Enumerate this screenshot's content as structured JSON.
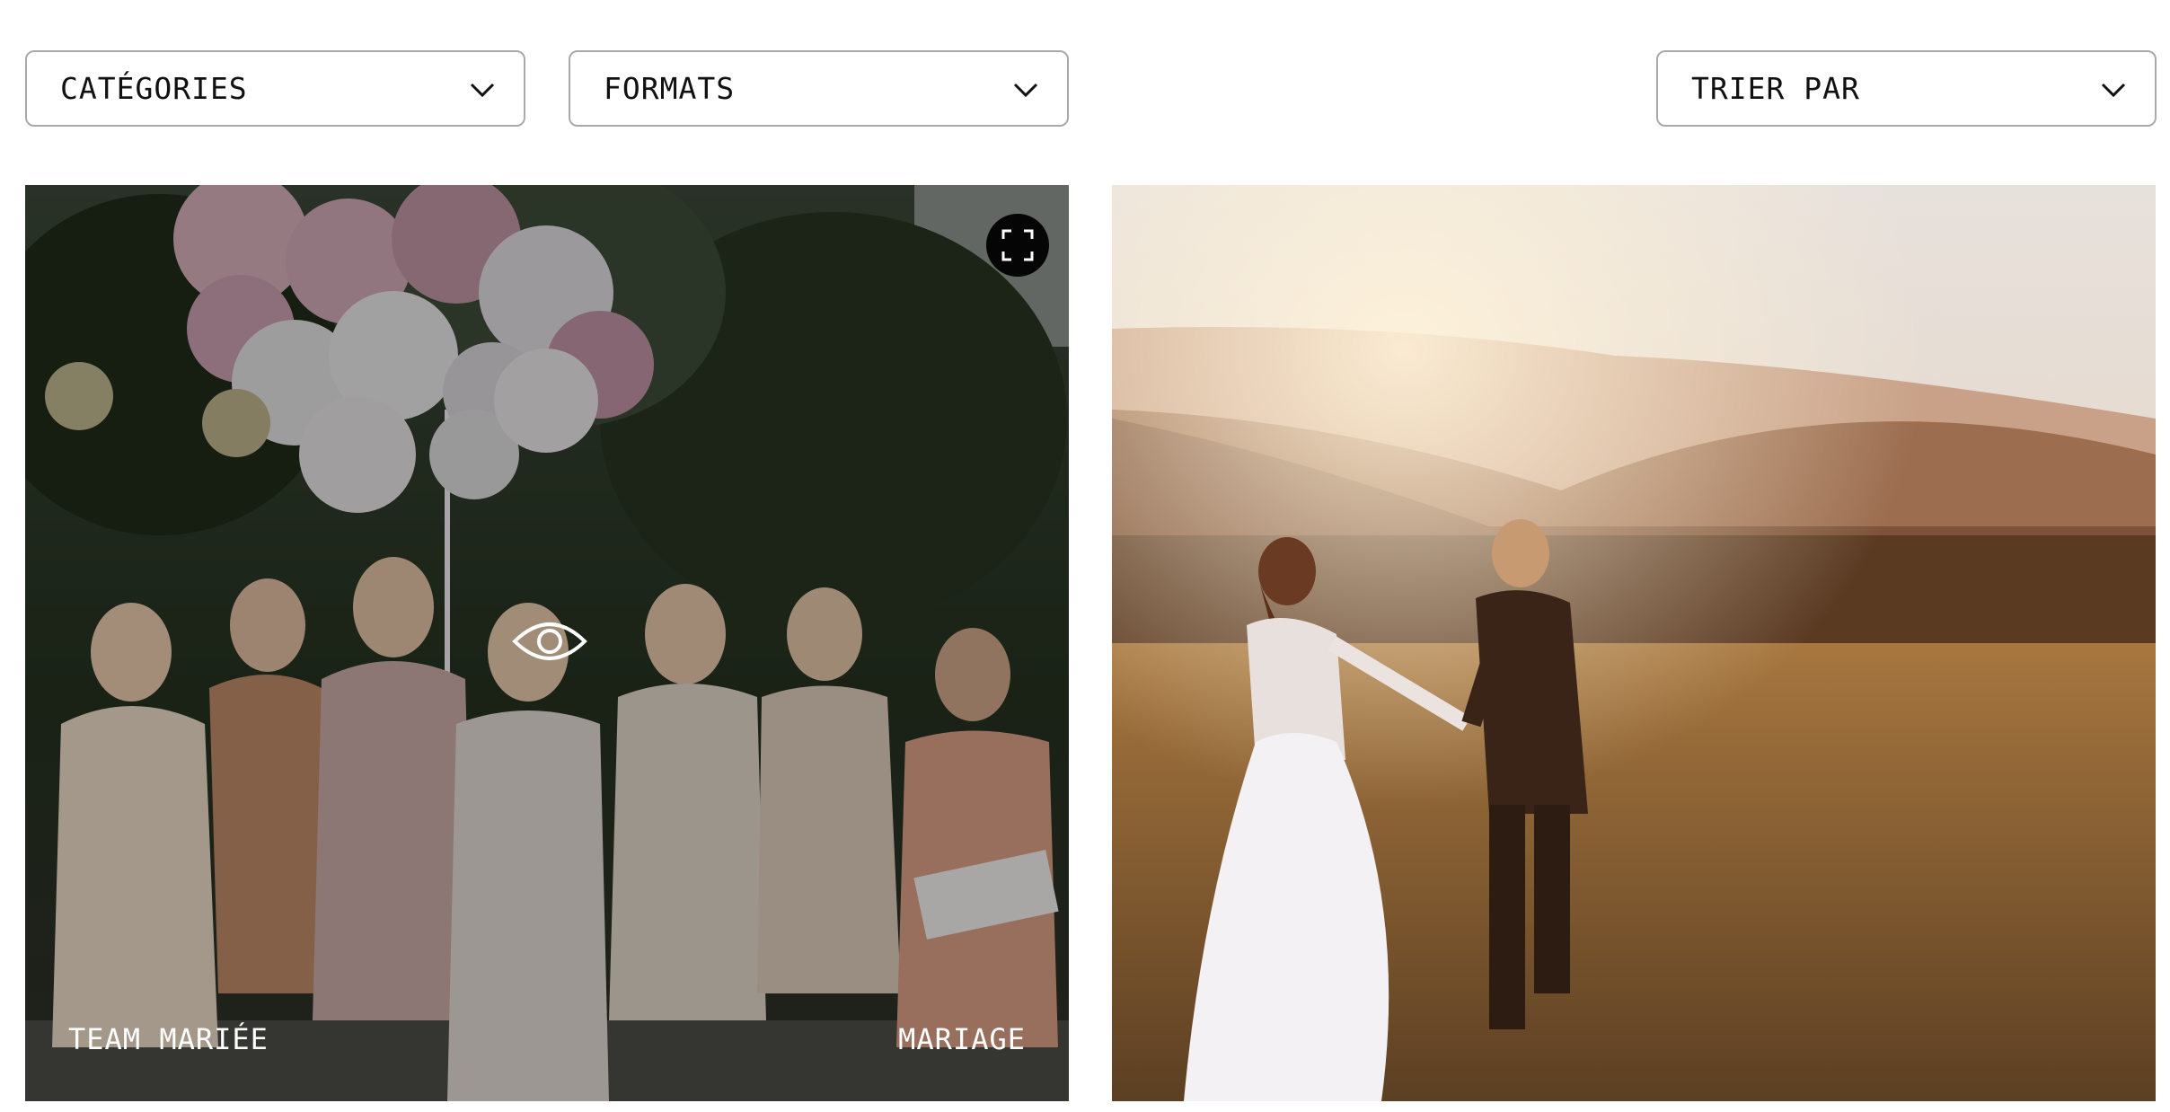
{
  "filters": {
    "categories": "CATÉGORIES",
    "formats": "FORMATS",
    "sort": "TRIER PAR"
  },
  "icons": {
    "dropdown": "chevron-down-icon",
    "expand": "expand-icon",
    "preview": "eye-icon"
  },
  "gallery": {
    "items": [
      {
        "title": "TEAM MARIÉE",
        "category": "MARIAGE"
      },
      {
        "title": "",
        "category": ""
      }
    ]
  }
}
